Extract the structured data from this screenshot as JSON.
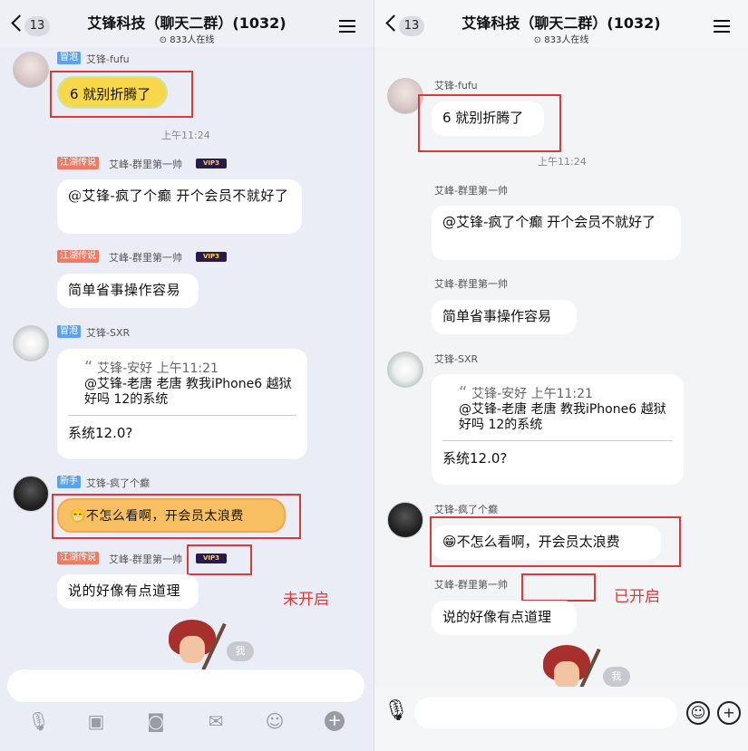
{
  "header": {
    "badge": "13",
    "title": "艾锋科技（聊天二群）(1032)",
    "online": "⊙ 833人在线"
  },
  "left": {
    "m1": {
      "tag": "冒泡",
      "nick": "艾锋-fufu",
      "text": "6 就别折腾了"
    },
    "time": "上午11:24",
    "m2": {
      "tag": "江湖传说",
      "nick": "艾峰-群里第一帅",
      "vip": "VIP3",
      "text": "@艾锋-疯了个癫 开个会员不就好了"
    },
    "m3": {
      "tag": "江湖传说",
      "nick": "艾峰-群里第一帅",
      "vip": "VIP3",
      "text": "简单省事操作容易"
    },
    "m4": {
      "tag": "冒泡",
      "nick": "艾锋-SXR",
      "quote_head": "艾锋-安好 上午11:21",
      "quote_text": "@艾锋-老唐 老唐 教我iPhone6 越狱好吗 12的系统",
      "text": "系统12.0?"
    },
    "m5": {
      "tag": "新手",
      "nick": "艾锋-疯了个癫",
      "text": "😁不怎么看啊，开会员太浪费"
    },
    "m6": {
      "tag": "江湖传说",
      "nick": "艾峰-群里第一帅",
      "vip": "VIP3",
      "text": "说的好像有点道理"
    },
    "note": "未开启",
    "me": "我"
  },
  "right": {
    "m1": {
      "nick": "艾锋-fufu",
      "text": "6 就别折腾了"
    },
    "time": "上午11:24",
    "m2": {
      "nick": "艾峰-群里第一帅",
      "text": "@艾锋-疯了个癫 开个会员不就好了"
    },
    "m3": {
      "nick": "艾峰-群里第一帅",
      "text": "简单省事操作容易"
    },
    "m4": {
      "nick": "艾锋-SXR",
      "quote_head": "艾锋-安好 上午11:21",
      "quote_text": "@艾锋-老唐 老唐 教我iPhone6 越狱好吗 12的系统",
      "text": "系统12.0?"
    },
    "m5": {
      "nick": "艾锋-疯了个癫",
      "text": "😁不怎么看啊，开会员太浪费"
    },
    "m6": {
      "nick": "艾峰-群里第一帅",
      "text": "说的好像有点道理"
    },
    "note": "已开启",
    "me": "我"
  },
  "icons": {
    "mic": "🎙",
    "image": "▣",
    "camera": "◙",
    "gift": "✉",
    "emoji": "☺",
    "plus": "+"
  },
  "colors": {
    "annotation": "#d93a3a",
    "bg_left": "#eaedf6",
    "bg_right": "#f3f4f6"
  }
}
